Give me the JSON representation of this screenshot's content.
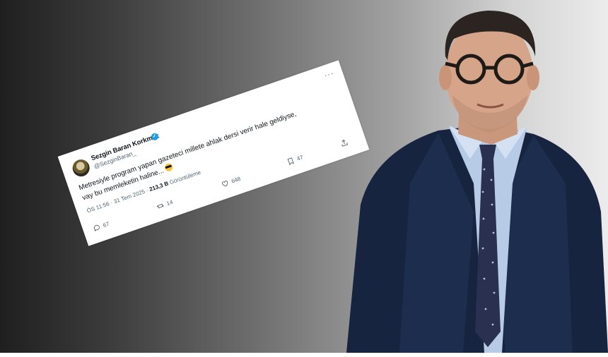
{
  "tweet": {
    "display_name": "Sezgin Baran Korkmaz",
    "handle": "@SezginBaran_",
    "text_line1": "Metresiyle program yapan gazeteci millete ahlak dersi verir hale geldiyse,",
    "text_line2": "vay bu memleketin haline...",
    "time": "ÖS 11:56 · 31 Tem 2025 ·",
    "views_count": "213,3 B",
    "views_label": "Görüntüleme",
    "replies": "67",
    "retweets": "14",
    "likes": "648",
    "bookmarks": "47",
    "verified_color": "#1d9bf0"
  },
  "icons": [
    "more-icon",
    "verified-icon",
    "reply-icon",
    "retweet-icon",
    "like-icon",
    "bookmark-icon",
    "share-icon"
  ]
}
